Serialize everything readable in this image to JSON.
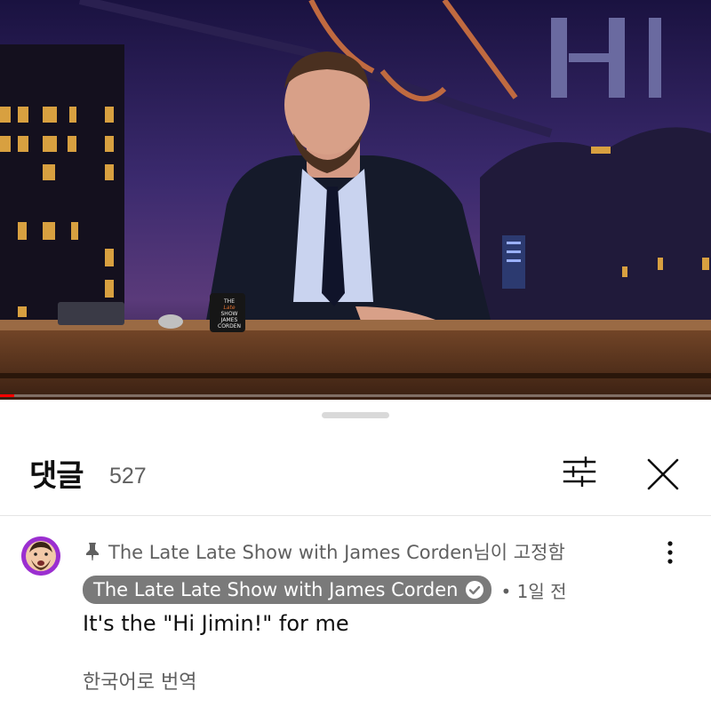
{
  "video": {
    "desk_sign": [
      "THE",
      "Late",
      "SHOW",
      "JAMES",
      "CORDEN"
    ],
    "progress_percent": 2
  },
  "comments_panel": {
    "title": "댓글",
    "count": "527",
    "filter_icon": "sliders-icon",
    "close_icon": "close-icon"
  },
  "comment": {
    "avatar_icon": "avatar-image",
    "pinned_icon": "pin-icon",
    "pinned_text": "The Late Late Show with James Corden님이 고정함",
    "author": "The Late Late Show with James Corden",
    "verified_icon": "verified-check-icon",
    "time": "• 1일 전",
    "text": "It's the \"Hi Jimin!\" for me",
    "translate_label": "한국어로 번역",
    "more_icon": "more-vertical-icon"
  },
  "colors": {
    "accent_red": "#ff0000",
    "chip_bg": "#7a7a7a",
    "avatar_bg": "#9b2fd0",
    "secondary_text": "#606060"
  }
}
